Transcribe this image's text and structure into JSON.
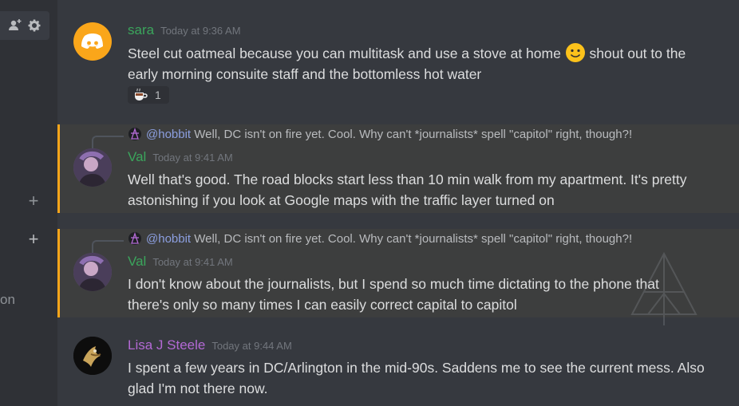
{
  "colors": {
    "background": "#36393f",
    "sidebar": "#2f3136",
    "highlight_bar": "#faa61a",
    "name_sara": "#3ba55c",
    "name_val": "#3ba55c",
    "name_lisa": "#b369d4",
    "mention": "#8c9fe0"
  },
  "sidebar": {
    "icons": [
      "add-user-icon",
      "gear-icon",
      "plus-icon",
      "plus-icon"
    ],
    "partial_text": "on"
  },
  "messages": [
    {
      "author": "sara",
      "timestamp": "Today at 9:36 AM",
      "text_before_emoji": "Steel cut oatmeal because you can multitask and use a stove at home ",
      "text_after_emoji": " shout out to the early morning consuite staff and the bottomless hot water",
      "reaction": {
        "emoji": "coffee-icon",
        "count": "1"
      }
    },
    {
      "author": "Val",
      "timestamp": "Today at 9:41 AM",
      "reply_to": "@hobbit",
      "reply_text": "Well, DC isn't on fire yet.  Cool.  Why can't *journalists* spell \"capitol\" right, though?!",
      "text": "Well that's good. The road blocks start less than 10 min walk from my apartment. It's pretty astonishing if you look at Google maps with the traffic layer  turned on"
    },
    {
      "author": "Val",
      "timestamp": "Today at 9:41 AM",
      "reply_to": "@hobbit",
      "reply_text": "Well, DC isn't on fire yet.  Cool.  Why can't *journalists* spell \"capitol\" right, though?!",
      "text": "I don't know about the journalists, but I spend so much time dictating to the phone that there's only so many times I can easily correct capital to capitol"
    },
    {
      "author": "Lisa J Steele",
      "timestamp": "Today at 9:44 AM",
      "text": "I spent a few years in DC/Arlington in the mid-90s. Saddens me to see the current mess. Also glad I'm not there now."
    }
  ]
}
